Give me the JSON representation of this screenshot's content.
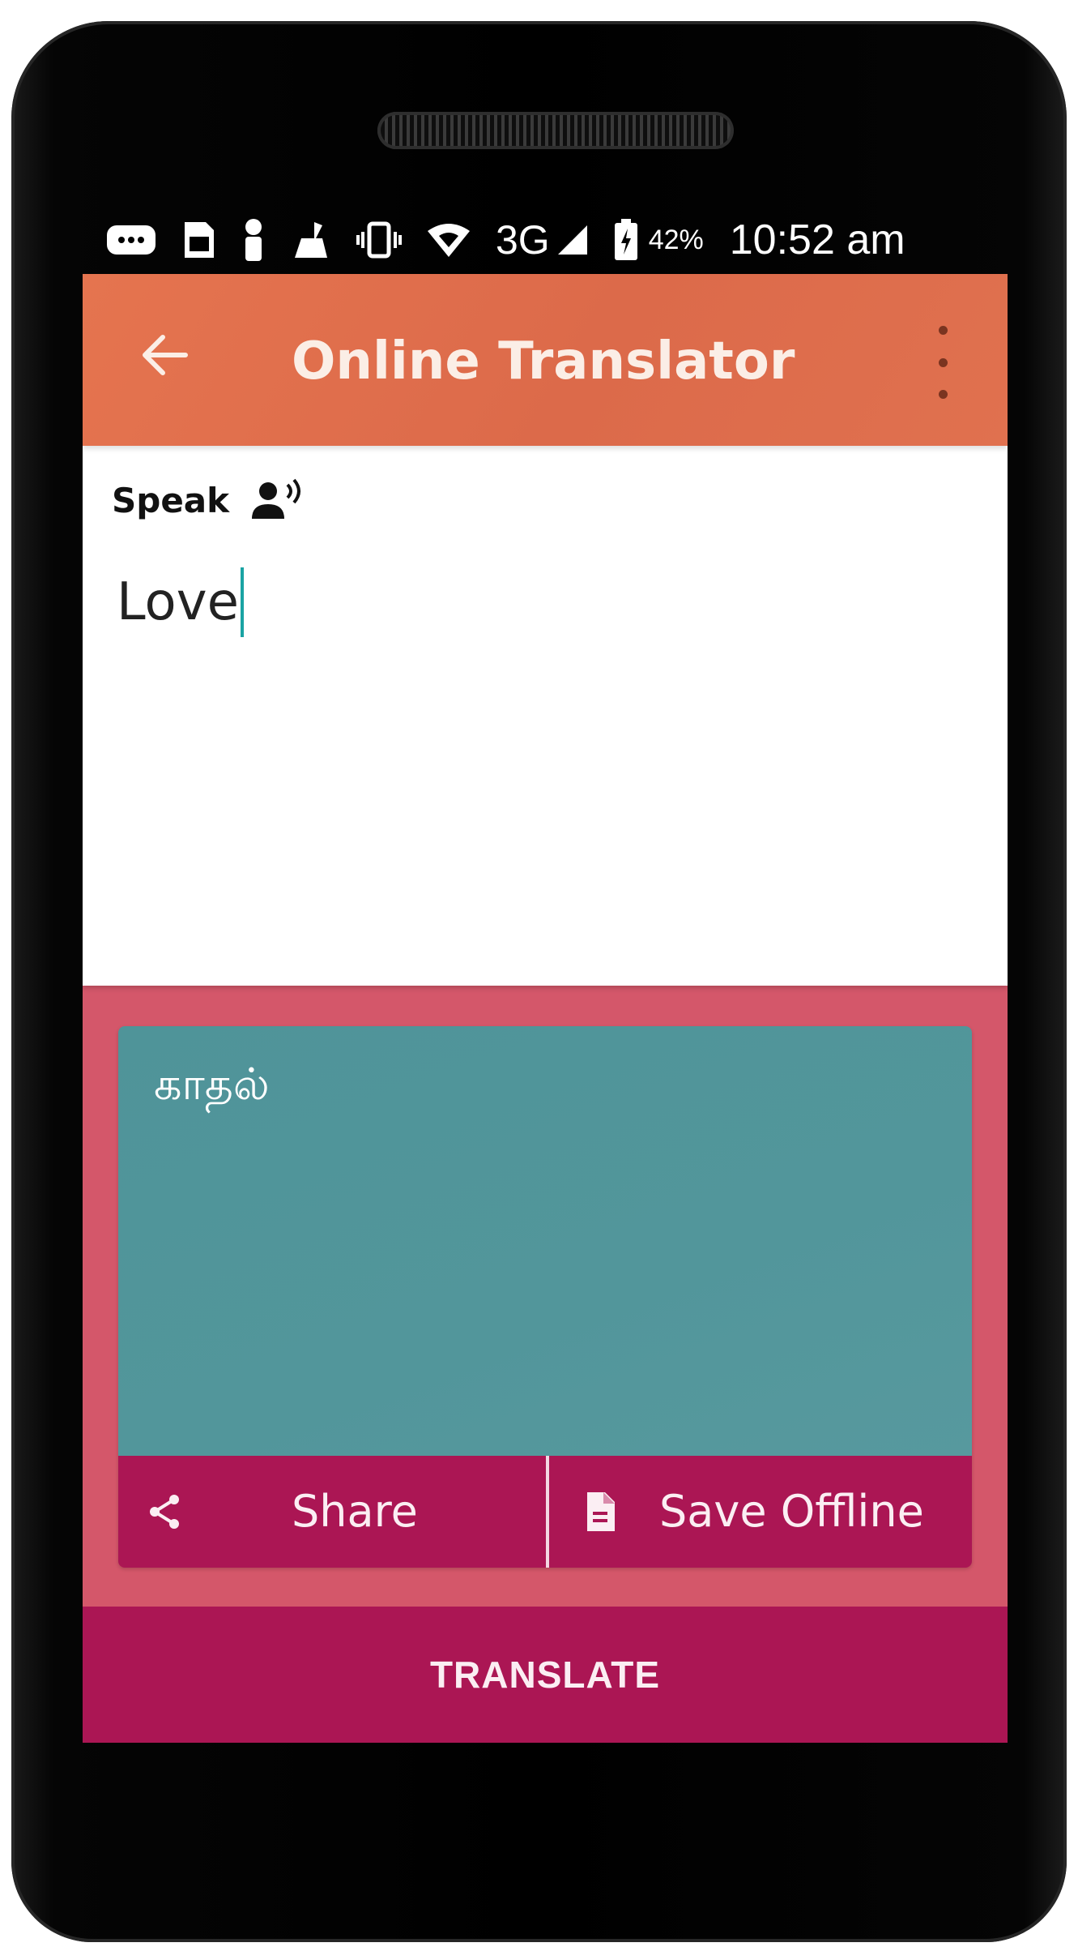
{
  "status_bar": {
    "icons": [
      "message-icon",
      "sim-icon",
      "person-icon",
      "cleaner-icon",
      "vibrate-icon",
      "wifi-icon",
      "signal-icon",
      "battery-icon"
    ],
    "network": "3G",
    "battery_percent": "42%",
    "time": "10:52 am"
  },
  "app_bar": {
    "title": "Online Translator",
    "back_icon": "arrow-left-icon",
    "menu_icon": "more-vert-icon"
  },
  "input": {
    "speak_label": "Speak",
    "speak_icon": "record-voice-icon",
    "text": "Love"
  },
  "output": {
    "text": "காதல்"
  },
  "actions": {
    "share_label": "Share",
    "share_icon": "share-icon",
    "save_label": "Save Offline",
    "save_icon": "document-icon"
  },
  "translate_button": {
    "label": "TRANSLATE"
  },
  "colors": {
    "app_bar": "#e0704d",
    "screen_bg": "#d4576a",
    "output_bg": "#52969b",
    "accent": "#ab1654"
  }
}
